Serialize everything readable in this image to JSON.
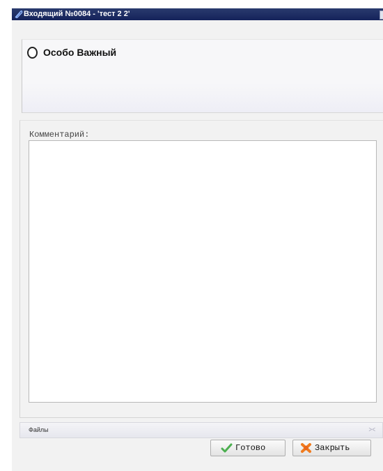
{
  "window": {
    "title": "Входящий №0084 - 'тест 2 2'"
  },
  "priority": {
    "label": "Особо Важный"
  },
  "comment": {
    "label": "Комментарий:",
    "value": ""
  },
  "files": {
    "label": "Файлы"
  },
  "buttons": {
    "done_label": "Готово",
    "close_label": "Закрыть"
  },
  "colors": {
    "titlebar": "#1b2a62",
    "done_icon": "#4caf50",
    "close_icon": "#f07b1e"
  }
}
